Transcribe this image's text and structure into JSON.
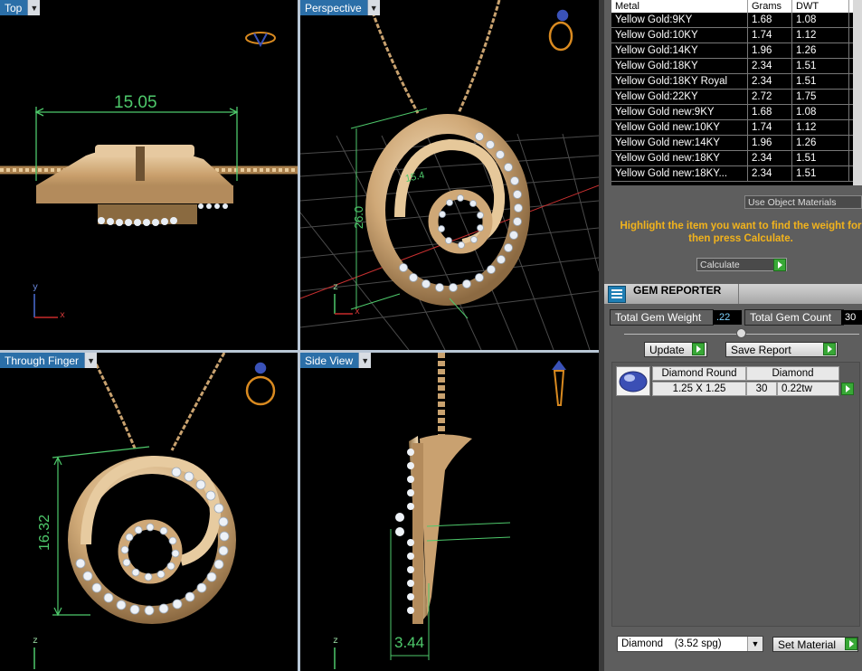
{
  "viewports": {
    "top": {
      "label": "Top",
      "dim": "15.05",
      "axes": {
        "y": "y",
        "x": "x"
      }
    },
    "perspective": {
      "label": "Perspective",
      "dim_a": "26.0",
      "dim_b": "15.4",
      "axes": {
        "z": "z",
        "x": "x"
      }
    },
    "finger": {
      "label": "Through Finger",
      "dim": "16.32",
      "axes": {
        "z": "z"
      }
    },
    "side": {
      "label": "Side View",
      "dim": "3.44",
      "axes": {
        "z": "z"
      }
    }
  },
  "metal_table": {
    "headers": [
      "Metal",
      "Grams",
      "DWT"
    ],
    "rows": [
      [
        "Yellow Gold:9KY",
        "1.68",
        "1.08"
      ],
      [
        "Yellow Gold:10KY",
        "1.74",
        "1.12"
      ],
      [
        "Yellow Gold:14KY",
        "1.96",
        "1.26"
      ],
      [
        "Yellow Gold:18KY",
        "2.34",
        "1.51"
      ],
      [
        "Yellow Gold:18KY Royal",
        "2.34",
        "1.51"
      ],
      [
        "Yellow Gold:22KY",
        "2.72",
        "1.75"
      ],
      [
        "Yellow Gold new:9KY",
        "1.68",
        "1.08"
      ],
      [
        "Yellow Gold new:10KY",
        "1.74",
        "1.12"
      ],
      [
        "Yellow Gold new:14KY",
        "1.96",
        "1.26"
      ],
      [
        "Yellow Gold new:18KY",
        "2.34",
        "1.51"
      ],
      [
        "Yellow Gold new:18KY...",
        "2.34",
        "1.51"
      ]
    ]
  },
  "use_object_materials": "Use Object Materials",
  "hint_text": "Highlight the item you want to find the weight for then press Calculate.",
  "calculate_label": "Calculate",
  "gem_reporter": {
    "title": "GEM REPORTER",
    "total_weight_label": "Total Gem Weight",
    "total_weight_value": ".22",
    "total_count_label": "Total Gem Count",
    "total_count_value": "30",
    "update_label": "Update",
    "save_report_label": "Save Report",
    "gem_row": {
      "name": "Diamond Round",
      "size": "1.25 X 1.25",
      "material": "Diamond",
      "count": "30",
      "weight": "0.22tw"
    }
  },
  "material_select": "Diamond    (3.52 spg)",
  "set_material_label": "Set Material",
  "colors": {
    "gold": "#d9b98a",
    "dim_green": "#4ec96b",
    "tab_blue": "#2b6fa8",
    "hint_orange": "#f2b31c",
    "green_btn": "#38a836"
  }
}
